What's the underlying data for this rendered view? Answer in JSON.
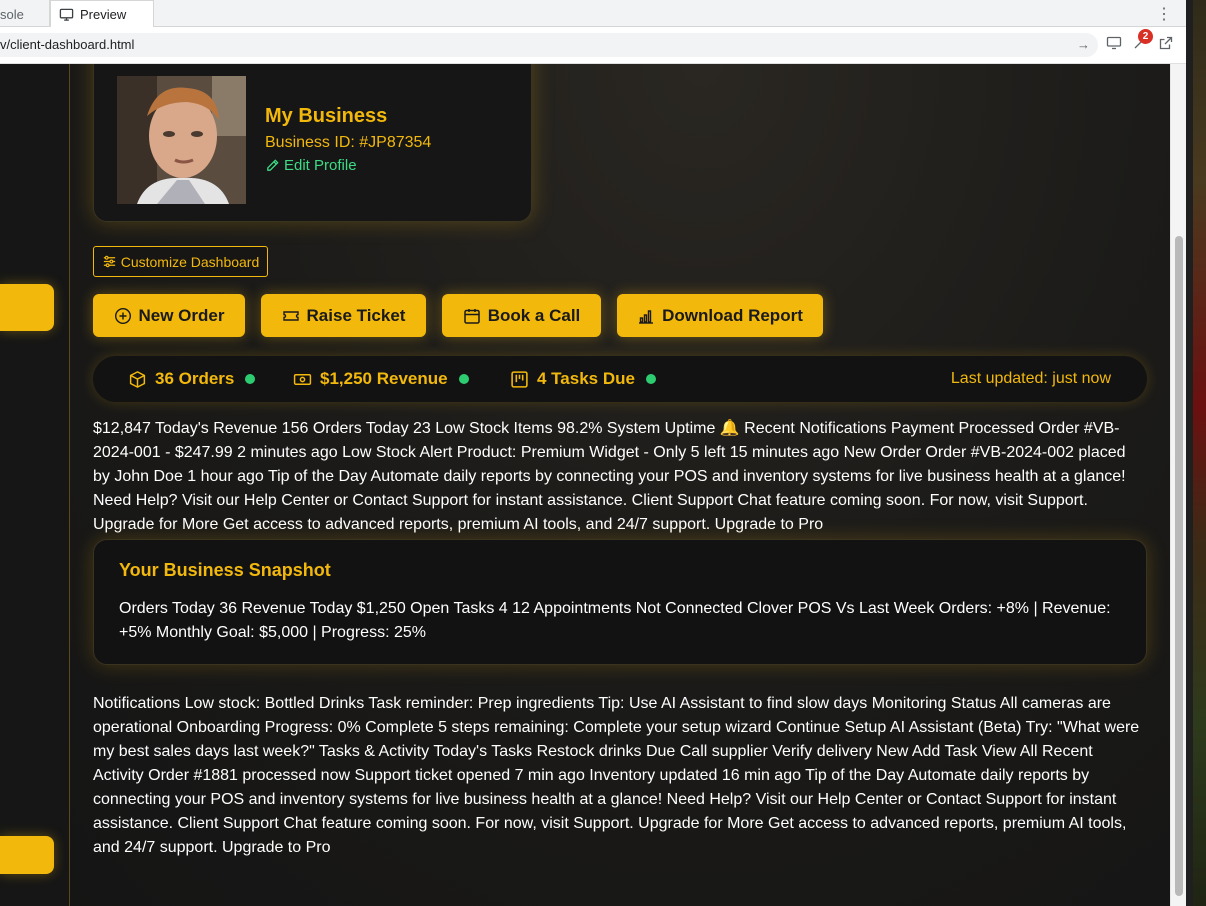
{
  "browser": {
    "tabs": [
      {
        "label": "sole"
      },
      {
        "label": "Preview"
      }
    ],
    "url": "v/client-dashboard.html",
    "extension_badge": "2"
  },
  "profile": {
    "business_name": "My Business",
    "business_id": "Business ID: #JP87354",
    "edit_label": "Edit Profile"
  },
  "customize_label": "Customize Dashboard",
  "actions": {
    "new_order": "New Order",
    "raise_ticket": "Raise Ticket",
    "book_call": "Book a Call",
    "download_report": "Download Report"
  },
  "stats": {
    "orders": "36 Orders",
    "revenue": "$1,250 Revenue",
    "tasks": "4 Tasks Due",
    "last_updated": "Last updated: just now"
  },
  "summary_text": "$12,847 Today's Revenue 156 Orders Today 23 Low Stock Items 98.2% System Uptime 🔔 Recent Notifications Payment Processed Order #VB-2024-001 - $247.99 2 minutes ago Low Stock Alert Product: Premium Widget - Only 5 left 15 minutes ago New Order Order #VB-2024-002 placed by John Doe 1 hour ago Tip of the Day Automate daily reports by connecting your POS and inventory systems for live business health at a glance! Need Help? Visit our Help Center or Contact Support for instant assistance. Client Support Chat feature coming soon. For now, visit Support. Upgrade for More Get access to advanced reports, premium AI tools, and 24/7 support. Upgrade to Pro",
  "snapshot": {
    "title": "Your Business Snapshot",
    "text": "Orders Today 36 Revenue Today $1,250 Open Tasks 4 12 Appointments Not Connected Clover POS Vs Last Week Orders: +8% | Revenue: +5% Monthly Goal: $5,000 | Progress: 25%"
  },
  "details_text": "Notifications Low stock: Bottled Drinks Task reminder: Prep ingredients Tip: Use AI Assistant to find slow days Monitoring Status All cameras are operational Onboarding Progress: 0% Complete 5 steps remaining: Complete your setup wizard Continue Setup AI Assistant (Beta) Try: \"What were my best sales days last week?\" Tasks & Activity Today's Tasks Restock drinks Due Call supplier Verify delivery New Add Task View All Recent Activity Order #1881 processed now Support ticket opened 7 min ago Inventory updated 16 min ago Tip of the Day Automate daily reports by connecting your POS and inventory systems for live business health at a glance! Need Help? Visit our Help Center or Contact Support for instant assistance. Client Support Chat feature coming soon. For now, visit Support. Upgrade for More Get access to advanced reports, premium AI tools, and 24/7 support. Upgrade to Pro",
  "colors": {
    "accent": "#f2b80c",
    "success": "#3ddc84",
    "status_dot": "#2ecc71",
    "background": "#161616"
  },
  "icons": {
    "preview_tab": "monitor-icon",
    "edit": "pencil-icon",
    "customize": "sliders-icon",
    "new_order": "plus-circle-icon",
    "raise_ticket": "ticket-icon",
    "book_call": "calendar-icon",
    "download_report": "bar-chart-icon",
    "orders": "box-icon",
    "revenue": "cash-icon",
    "tasks": "kanban-icon"
  }
}
